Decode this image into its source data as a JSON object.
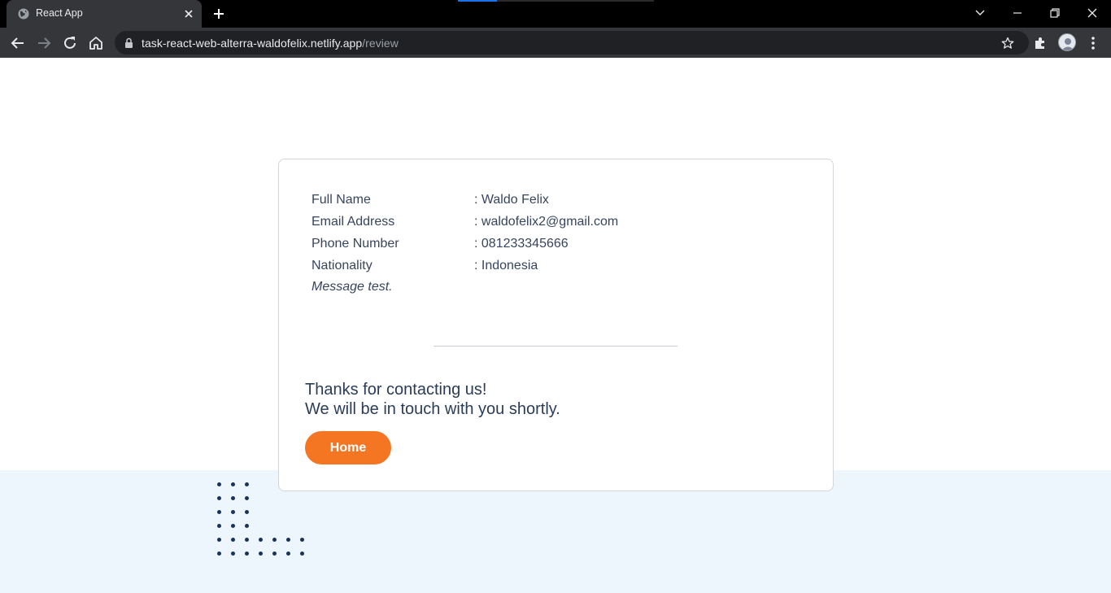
{
  "browser": {
    "tab_title": "React App",
    "url_host": "task-react-web-alterra-waldofelix.netlify.app",
    "url_path": "/review"
  },
  "review": {
    "fields": [
      {
        "label": "Full Name",
        "value": ": Waldo Felix"
      },
      {
        "label": "Email Address",
        "value": ": waldofelix2@gmail.com"
      },
      {
        "label": "Phone Number",
        "value": ": 081233345666"
      },
      {
        "label": "Nationality",
        "value": ": Indonesia"
      }
    ],
    "message": "Message test.",
    "thanks_line1": "Thanks for contacting us!",
    "thanks_line2": "We will be in touch with you shortly.",
    "home_button": "Home"
  },
  "colors": {
    "accent": "#f47522",
    "text": "#36455d",
    "band": "#edf5fd",
    "dots": "#18345b"
  }
}
